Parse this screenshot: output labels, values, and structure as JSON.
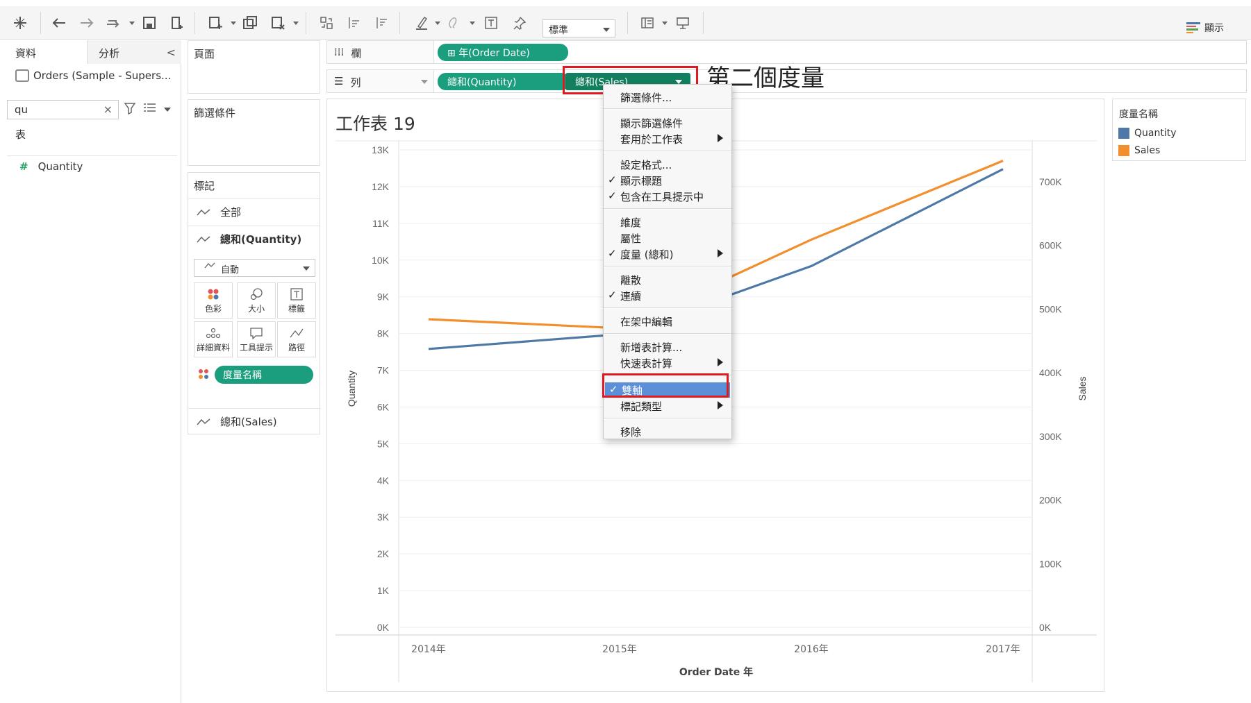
{
  "toolbar": {
    "fit_select": "標準",
    "show_me_label": "顯示"
  },
  "data_pane": {
    "tab_data": "資料",
    "tab_analytics": "分析",
    "datasource": "Orders (Sample - Supers...",
    "search_value": "qu",
    "section_label": "表",
    "field": "Quantity"
  },
  "pages_card": {
    "title": "頁面"
  },
  "filters_card": {
    "title": "篩選條件"
  },
  "marks_card": {
    "title": "標記",
    "row_all": "全部",
    "row_quantity": "總和(Quantity)",
    "mark_type": "自動",
    "buttons": {
      "color": "色彩",
      "size": "大小",
      "label": "標籤",
      "detail": "詳細資料",
      "tooltip": "工具提示",
      "path": "路徑"
    },
    "measure_names_pill": "度量名稱",
    "row_sales": "總和(Sales)"
  },
  "shelves": {
    "columns_label": "欄",
    "columns_pill": "年(Order Date)",
    "rows_label": "列",
    "rows_pill_1": "總和(Quantity)",
    "rows_pill_2": "總和(Sales)"
  },
  "annotation": "第二個度量",
  "sheet": {
    "title": "工作表 19"
  },
  "legend": {
    "title": "度量名稱",
    "items": [
      {
        "name": "Quantity",
        "color": "#4e79a7"
      },
      {
        "name": "Sales",
        "color": "#f28e2b"
      }
    ]
  },
  "context_menu": {
    "filter": "篩選條件...",
    "show_filter": "顯示篩選條件",
    "apply_to_sheets": "套用於工作表",
    "format": "設定格式...",
    "show_header": "顯示標題",
    "include_tooltip": "包含在工具提示中",
    "dimension": "維度",
    "attribute": "屬性",
    "measure": "度量 (總和)",
    "discrete": "離散",
    "continuous": "連續",
    "edit_in_shelf": "在架中編輯",
    "add_calc": "新增表計算...",
    "quick_calc": "快速表計算",
    "dual_axis": "雙軸",
    "mark_type": "標記類型",
    "remove": "移除",
    "check": "✓"
  },
  "chart_data": {
    "type": "line",
    "categories": [
      "2014年",
      "2015年",
      "2016年",
      "2017年"
    ],
    "xlabel": "Order Date 年",
    "ylabel": "Quantity",
    "y2label": "Sales",
    "ylim": [
      0,
      13000
    ],
    "y2lim": [
      0,
      750000
    ],
    "yticks": [
      "0K",
      "1K",
      "2K",
      "3K",
      "4K",
      "5K",
      "6K",
      "7K",
      "8K",
      "9K",
      "10K",
      "11K",
      "12K",
      "13K"
    ],
    "y2ticks": [
      "0K",
      "100K",
      "200K",
      "300K",
      "400K",
      "500K",
      "600K",
      "700K"
    ],
    "series": [
      {
        "name": "Quantity",
        "axis": "left",
        "color": "#4e79a7",
        "values": [
          7581,
          7979,
          9837,
          12476
        ]
      },
      {
        "name": "Sales",
        "axis": "right",
        "color": "#f28e2b",
        "values": [
          484000,
          470000,
          609000,
          733000
        ]
      }
    ]
  }
}
